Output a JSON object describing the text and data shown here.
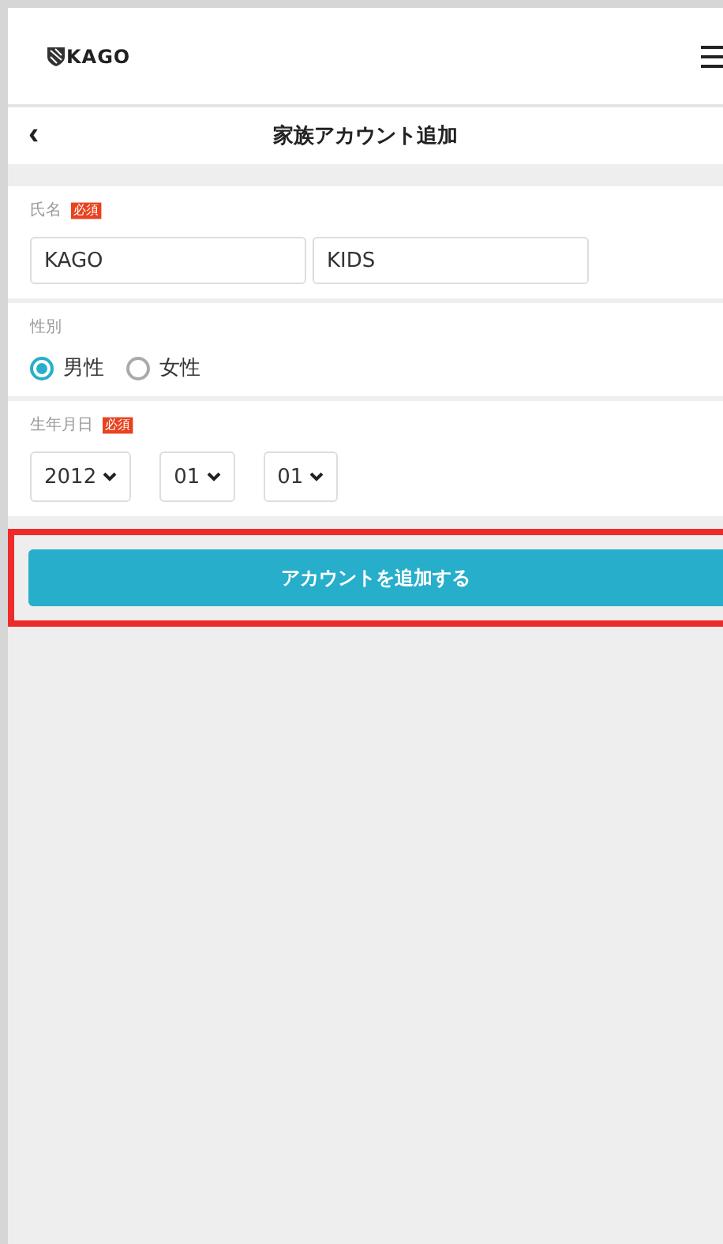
{
  "header": {
    "logo": "KAGO"
  },
  "nav": {
    "back": "‹",
    "title": "家族アカウント追加"
  },
  "name_section": {
    "label": "氏名",
    "required": "必須",
    "fields": [
      {
        "value": "KAGO"
      },
      {
        "value": "KIDS"
      }
    ]
  },
  "gender_section": {
    "label": "性別",
    "options": [
      {
        "label": "男性",
        "selected": true
      },
      {
        "label": "女性",
        "selected": false
      }
    ]
  },
  "birth_section": {
    "label": "生年月日",
    "required": "必須",
    "selects": [
      {
        "value": "2012"
      },
      {
        "value": "01"
      },
      {
        "value": "01"
      }
    ]
  },
  "submit": {
    "label": "アカウントを追加する",
    "highlighted": true
  }
}
